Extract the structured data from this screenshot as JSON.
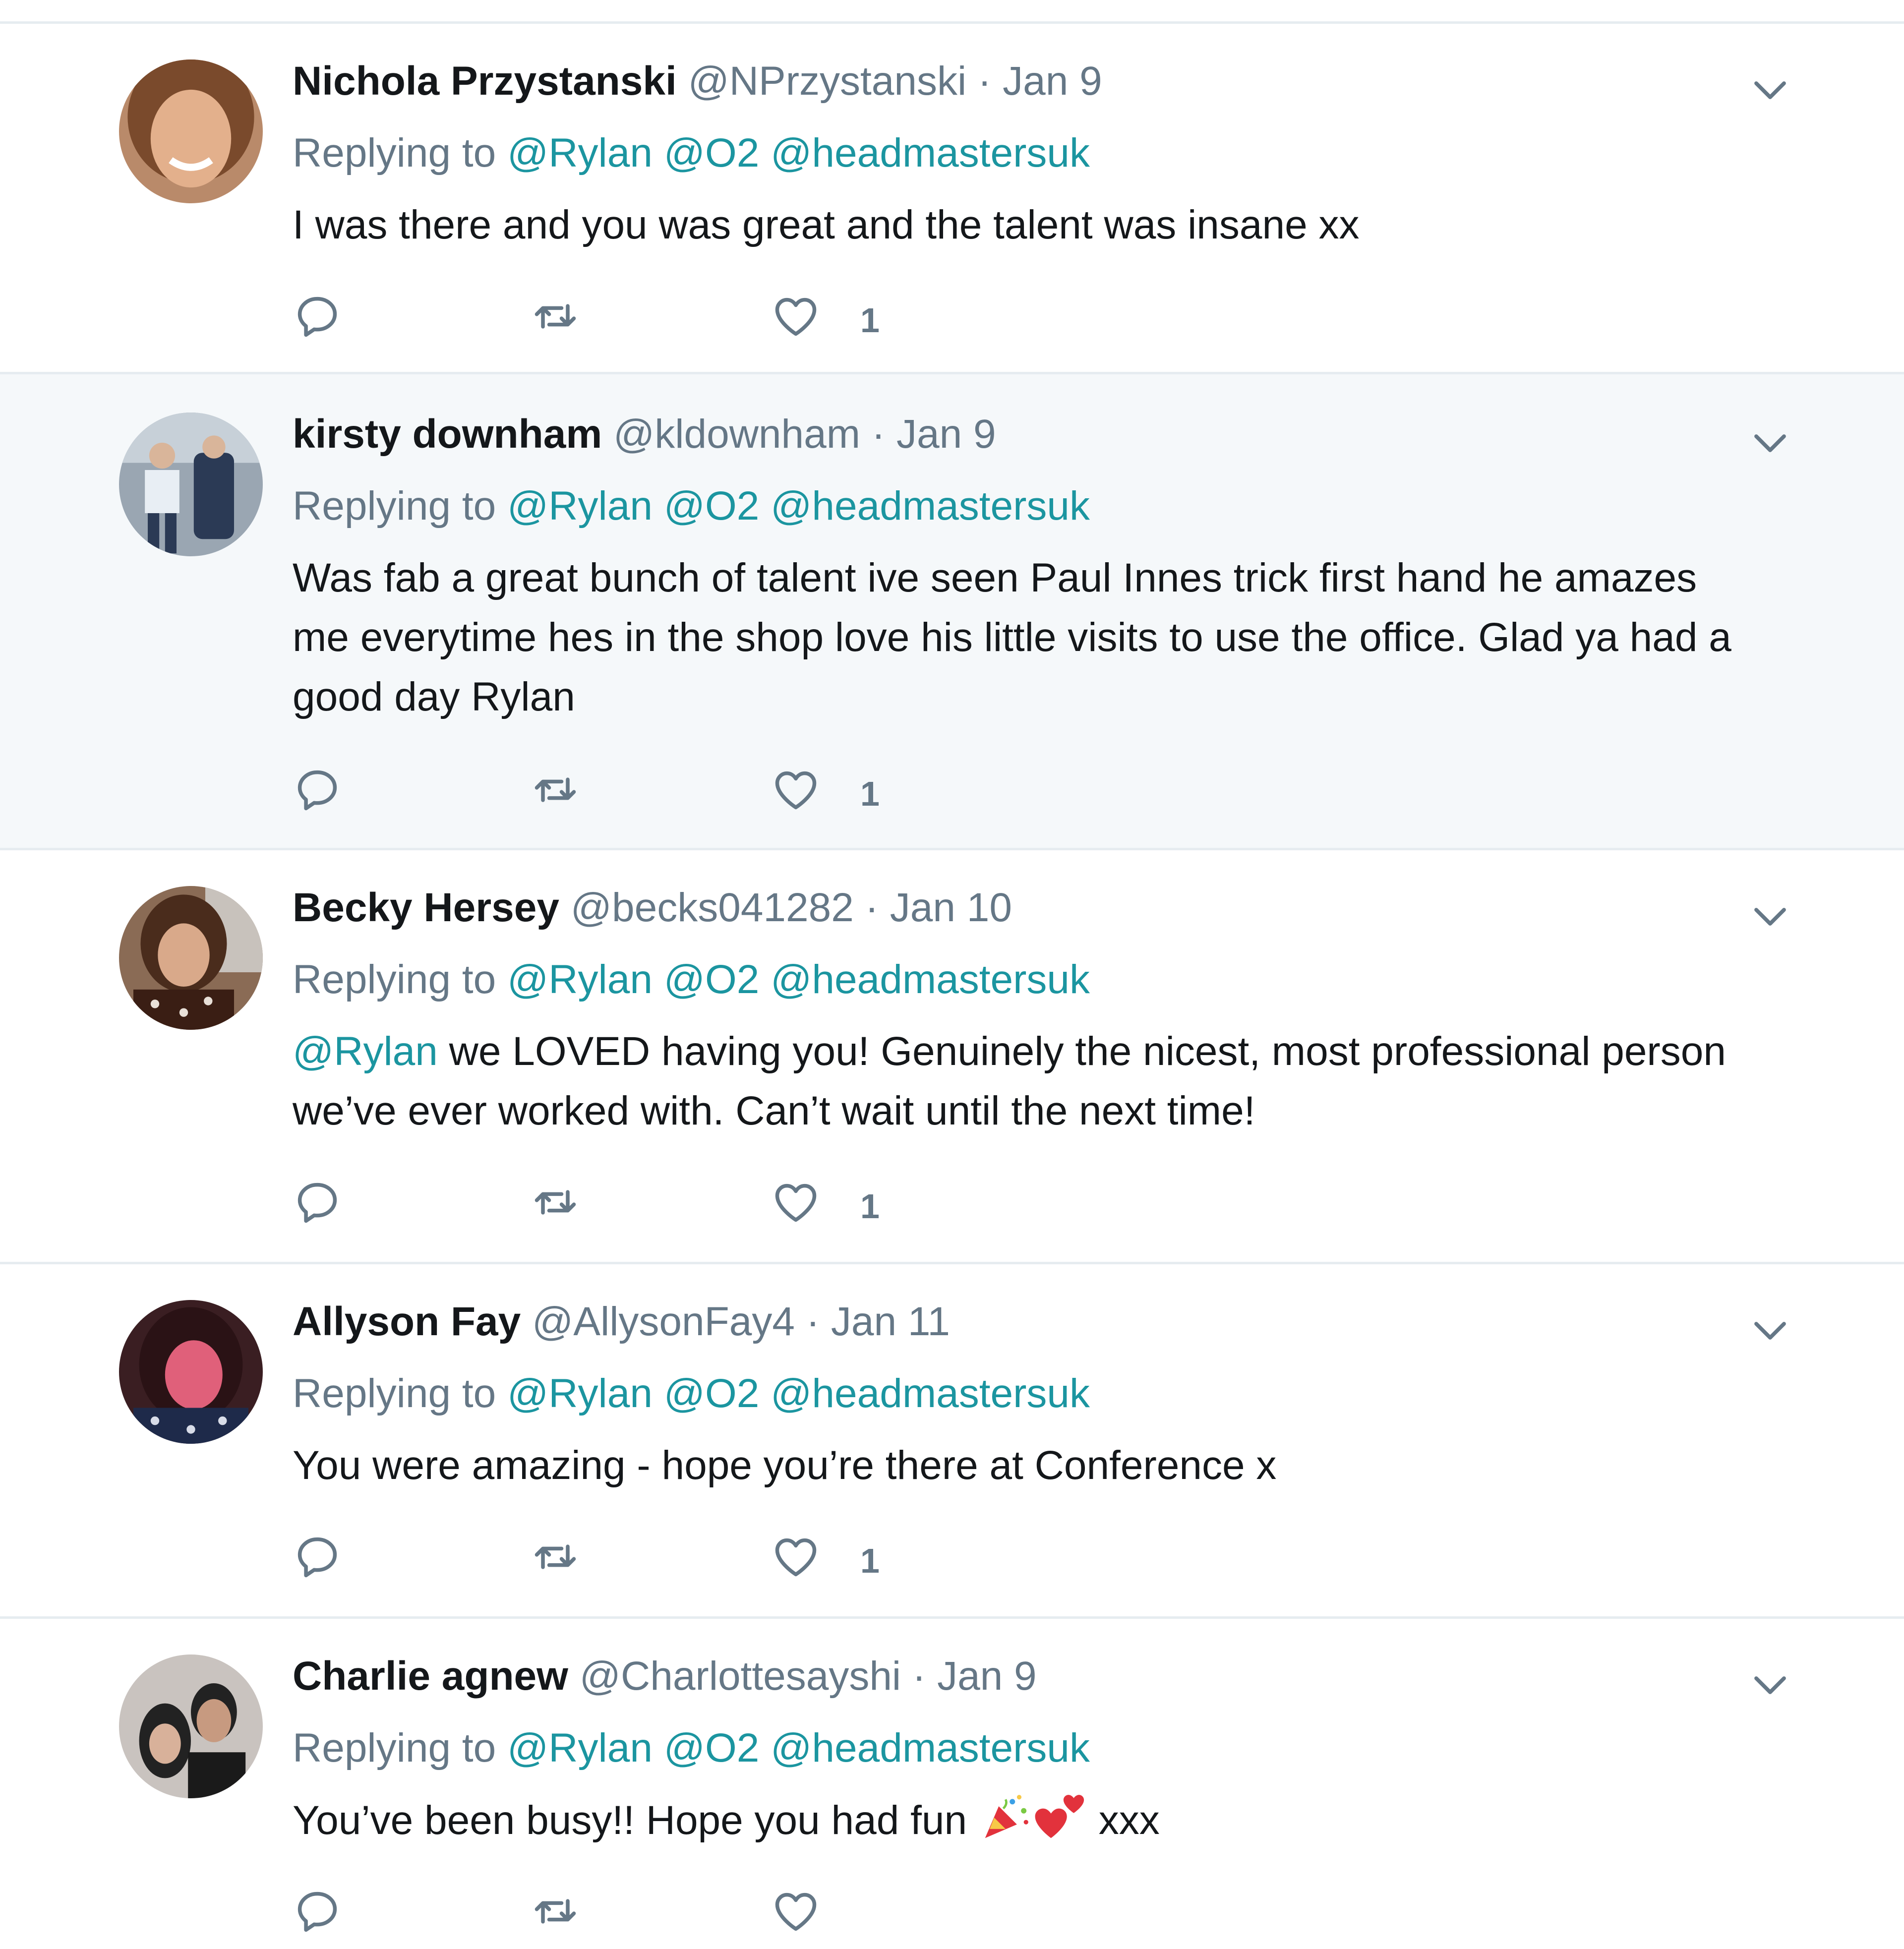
{
  "tweets": [
    {
      "name": "Nichola Przystanski",
      "handle": "@NPrzystanski",
      "dot": "·",
      "date": "Jan 9",
      "replying_prefix": "Replying to",
      "mentions": [
        "@Rylan",
        "@O2",
        "@headmastersuk"
      ],
      "text_lines": [
        "I was there and you was great and the talent was insane xx"
      ],
      "likes": "1",
      "avatar_colors": {
        "bg": "#b98a6a",
        "face": "#e3b08c",
        "hair": "#7a4a2c"
      }
    },
    {
      "name": "kirsty downham",
      "handle": "@kldownham",
      "dot": "·",
      "date": "Jan 9",
      "replying_prefix": "Replying to",
      "mentions": [
        "@Rylan",
        "@O2",
        "@headmastersuk"
      ],
      "text_lines": [
        "Was fab a great bunch of talent ive seen Paul Innes trick first hand he amazes",
        "me everytime hes in the shop love his little visits to use the office. Glad ya had a",
        "good day Rylan"
      ],
      "likes": "1",
      "avatar_colors": {
        "bg": "#9aa6b2",
        "face": "#dfe6ee",
        "hair": "#2b3a55"
      }
    },
    {
      "name": "Becky Hersey",
      "handle": "@becks041282",
      "dot": "·",
      "date": "Jan 10",
      "replying_prefix": "Replying to",
      "mentions": [
        "@Rylan",
        "@O2",
        "@headmastersuk"
      ],
      "text_mention": "@Rylan",
      "text_lines": [
        " we LOVED having you! Genuinely the nicest, most professional person",
        "we’ve ever worked with. Can’t wait until the next time!"
      ],
      "likes": "1",
      "avatar_colors": {
        "bg": "#8a6b55",
        "face": "#d9a98a",
        "hair": "#4a2c1c"
      }
    },
    {
      "name": "Allyson Fay",
      "handle": "@AllysonFay4",
      "dot": "·",
      "date": "Jan 11",
      "replying_prefix": "Replying to",
      "mentions": [
        "@Rylan",
        "@O2",
        "@headmastersuk"
      ],
      "text_lines": [
        "You were amazing - hope you’re there at Conference x"
      ],
      "likes": "1",
      "avatar_colors": {
        "bg": "#3a1e22",
        "face": "#e0607a",
        "hair": "#2a1215"
      }
    },
    {
      "name": "Charlie agnew",
      "handle": "@Charlottesayshi",
      "dot": "·",
      "date": "Jan 9",
      "replying_prefix": "Replying to",
      "mentions": [
        "@Rylan",
        "@O2",
        "@headmastersuk"
      ],
      "text_before_emoji": "You’ve been busy!! Hope you had fun ",
      "emoji_names": [
        "party-popper-emoji",
        "two-hearts-emoji"
      ],
      "text_after_emoji": " xxx",
      "likes": "",
      "avatar_colors": {
        "bg": "#c9c3bf",
        "face": "#d8b19a",
        "hair": "#222222"
      }
    }
  ],
  "colors": {
    "link": "#1b95a0",
    "secondary": "#657786",
    "highlight_bg": "#f5f8fa",
    "divider": "#e6ecf0"
  }
}
